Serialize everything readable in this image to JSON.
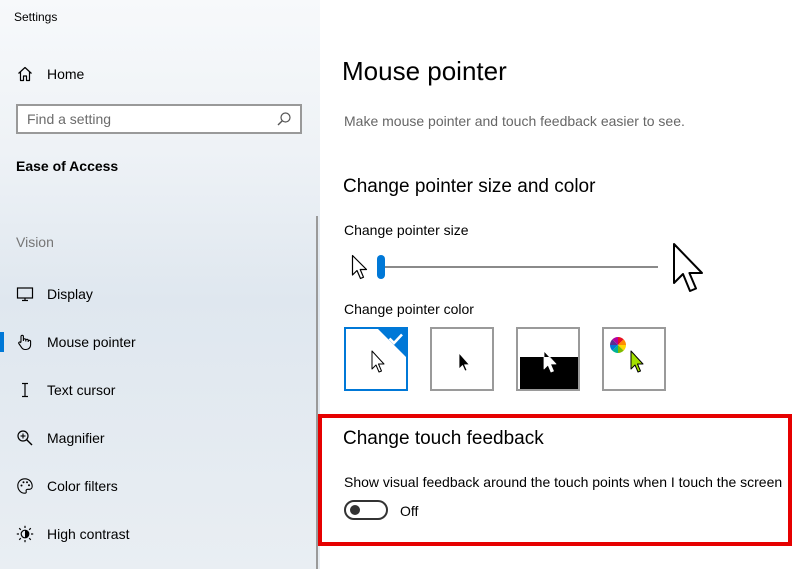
{
  "window": {
    "title": "Settings"
  },
  "sidebar": {
    "home_label": "Home",
    "search_placeholder": "Find a setting",
    "section_title": "Ease of Access",
    "group_label": "Vision",
    "items": [
      {
        "label": "Display",
        "icon": "display-icon"
      },
      {
        "label": "Mouse pointer",
        "icon": "mouse-pointer-icon",
        "active": true
      },
      {
        "label": "Text cursor",
        "icon": "text-cursor-icon"
      },
      {
        "label": "Magnifier",
        "icon": "magnifier-icon"
      },
      {
        "label": "Color filters",
        "icon": "color-filters-icon"
      },
      {
        "label": "High contrast",
        "icon": "high-contrast-icon"
      }
    ]
  },
  "main": {
    "title": "Mouse pointer",
    "description": "Make mouse pointer and touch feedback easier to see.",
    "pointer_section": {
      "heading": "Change pointer size and color",
      "size_label": "Change pointer size",
      "size_value": 1,
      "color_label": "Change pointer color",
      "color_options": [
        {
          "id": "white",
          "selected": true
        },
        {
          "id": "black",
          "selected": false
        },
        {
          "id": "inverted",
          "selected": false
        },
        {
          "id": "custom",
          "selected": false
        }
      ]
    },
    "touch_section": {
      "heading": "Change touch feedback",
      "description": "Show visual feedback around the touch points when I touch the screen",
      "toggle_state": "Off"
    }
  },
  "colors": {
    "accent": "#0078d7",
    "highlight": "#e60000"
  }
}
